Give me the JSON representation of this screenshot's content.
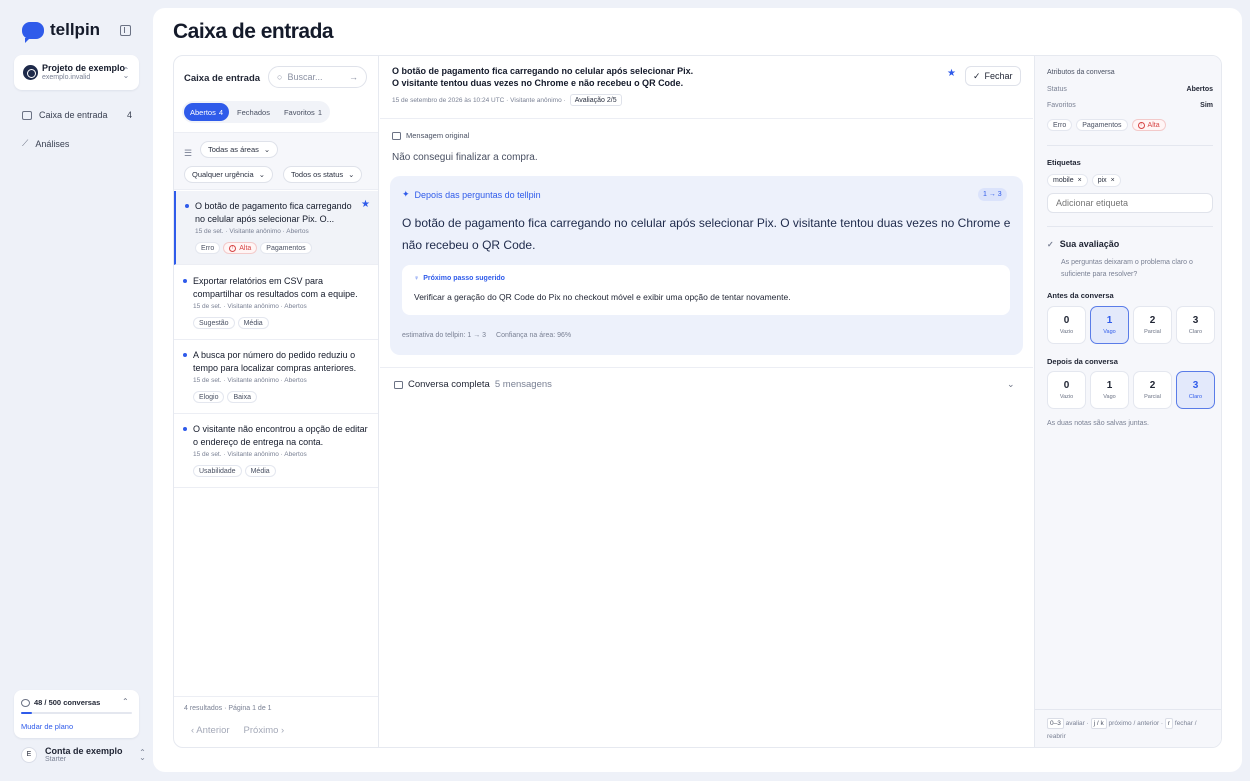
{
  "app": {
    "name": "tellpin"
  },
  "project": {
    "name": "Projeto de exemplo",
    "domain": "exemplo.invalid"
  },
  "nav": [
    {
      "label": "Caixa de entrada",
      "count": "4",
      "icon": "inbox-icon"
    },
    {
      "label": "Análises",
      "count": "",
      "icon": "chart-icon"
    }
  ],
  "usage": {
    "text": "48 / 500 conversas",
    "fraction": 0.096,
    "link": "Mudar de plano"
  },
  "account": {
    "initial": "E",
    "name": "Conta de exemplo",
    "plan": "Starter"
  },
  "page": {
    "title": "Caixa de entrada"
  },
  "list": {
    "title": "Caixa de entrada",
    "search_placeholder": "Buscar...",
    "tabs": [
      {
        "label": "Abertos",
        "count": "4",
        "active": true
      },
      {
        "label": "Fechados",
        "count": "",
        "active": false
      },
      {
        "label": "Favoritos",
        "count": "1",
        "active": false
      }
    ],
    "filters": {
      "area": "Todas as áreas",
      "urgency": "Qualquer urgência",
      "status": "Todos os status"
    },
    "items": [
      {
        "title": "O botão de pagamento fica carregando no celular após selecionar Pix. O...",
        "meta": "15 de set. · Visitante anônimo · Abertos",
        "tags": [
          "Erro",
          "Alta",
          "Pagamentos"
        ],
        "starred": true
      },
      {
        "title": "Exportar relatórios em CSV para compartilhar os resultados com a equipe.",
        "meta": "15 de set. · Visitante anônimo · Abertos",
        "tags": [
          "Sugestão",
          "Média"
        ],
        "starred": false
      },
      {
        "title": "A busca por número do pedido reduziu o tempo para localizar compras anteriores.",
        "meta": "15 de set. · Visitante anônimo · Abertos",
        "tags": [
          "Elogio",
          "Baixa"
        ],
        "starred": false
      },
      {
        "title": "O visitante não encontrou a opção de editar o endereço de entrega na conta.",
        "meta": "15 de set. · Visitante anônimo · Abertos",
        "tags": [
          "Usabilidade",
          "Média"
        ],
        "starred": false
      }
    ],
    "results": "4 resultados · Página 1 de 1",
    "prev": "Anterior",
    "next": "Próximo"
  },
  "detail": {
    "title_line1": "O botão de pagamento fica carregando no celular após selecionar Pix.",
    "title_line2": "O visitante tentou duas vezes no Chrome e não recebeu o QR Code.",
    "meta": "15 de setembro de 2026 às 10:24 UTC · Visitante anônimo ·",
    "eval_badge": "Avaliação 2/5",
    "close_label": "Fechar",
    "original_label": "Mensagem original",
    "original_text": "Não consegui finalizar a compra.",
    "after_label": "Depois das perguntas do tellpin",
    "step_badge": "1 → 3",
    "after_text": "O botão de pagamento fica carregando no celular após selecionar Pix. O visitante tentou duas vezes no Chrome e não recebeu o QR Code.",
    "next_label": "Próximo passo sugerido",
    "next_text": "Verificar a geração do QR Code do Pix no checkout móvel e exibir uma opção de tentar novamente.",
    "estimate": "estimativa do tellpin: 1 → 3",
    "confidence": "Confiança na área: 96%",
    "full_conv_label": "Conversa completa",
    "full_conv_count": "5 mensagens"
  },
  "attributes": {
    "title": "Atributos da conversa",
    "status_label": "Status",
    "status_value": "Abertos",
    "fav_label": "Favoritos",
    "fav_value": "Sim",
    "tags": [
      "Erro",
      "Pagamentos",
      "Alta"
    ],
    "labels_title": "Etiquetas",
    "labels": [
      "mobile",
      "pix"
    ],
    "label_placeholder": "Adicionar etiqueta",
    "eval_title": "Sua avaliação",
    "eval_desc": "As perguntas deixaram o problema claro o suficiente para resolver?",
    "before_title": "Antes da conversa",
    "after_title": "Depois da conversa",
    "scale": [
      {
        "n": "0",
        "l": "Vazio"
      },
      {
        "n": "1",
        "l": "Vago"
      },
      {
        "n": "2",
        "l": "Parcial"
      },
      {
        "n": "3",
        "l": "Claro"
      }
    ],
    "before_selected": 1,
    "after_selected": 3,
    "saved_note": "As duas notas são salvas juntas.",
    "shortcut_keys": [
      "0–3",
      "j / k",
      "r"
    ],
    "shortcut_texts": [
      "avaliar ·",
      "próximo / anterior ·",
      "fechar / reabrir"
    ]
  },
  "colors": {
    "accent": "#2f5bea",
    "danger": "#d64545"
  }
}
